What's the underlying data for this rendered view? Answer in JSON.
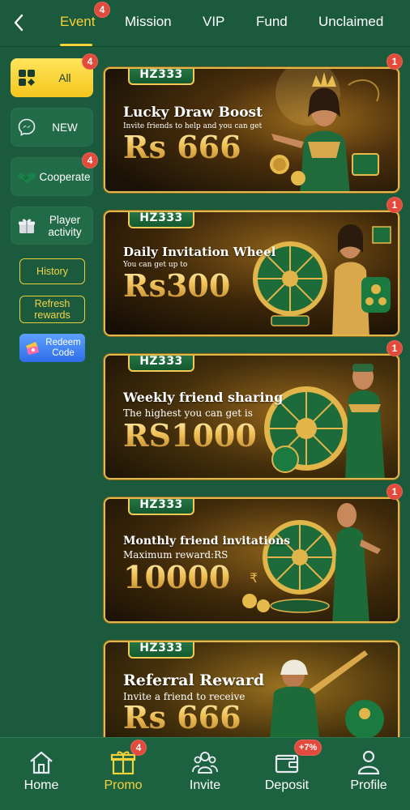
{
  "top_nav": {
    "tabs": [
      {
        "label": "Event",
        "badge": "4",
        "active": true
      },
      {
        "label": "Mission"
      },
      {
        "label": "VIP"
      },
      {
        "label": "Fund"
      },
      {
        "label": "Unclaimed"
      }
    ]
  },
  "sidebar": {
    "items": [
      {
        "label": "All",
        "badge": "4",
        "active": true,
        "icon": "grid-icon"
      },
      {
        "label": "NEW",
        "icon": "messenger-icon"
      },
      {
        "label": "Cooperate",
        "badge": "4",
        "icon": "handshake-icon"
      },
      {
        "label": "Player activity",
        "icon": "gift-icon"
      }
    ],
    "history_label": "History",
    "refresh_label": "Refresh rewards",
    "redeem_label": "Redeem Code"
  },
  "banners": [
    {
      "logo": "HZ333",
      "title": "Lucky Draw Boost",
      "subtitle": "Invite friends to help and you can get",
      "amount": "Rs 666",
      "badge": "1"
    },
    {
      "logo": "HZ333",
      "title": "Daily Invitation Wheel",
      "subtitle": "You can get up to",
      "amount": "Rs300",
      "badge": "1"
    },
    {
      "logo": "HZ333",
      "title": "Weekly friend sharing",
      "subtitle": "The highest you can get is",
      "amount": "RS1000",
      "badge": "1"
    },
    {
      "logo": "HZ333",
      "title": "Monthly friend invitations",
      "subtitle": "Maximum reward:RS",
      "amount": "10000",
      "badge": "1"
    },
    {
      "logo": "HZ333",
      "title": "Referral Reward",
      "subtitle": "Invite a friend to receive",
      "amount": "Rs 666"
    }
  ],
  "bottom_nav": {
    "items": [
      {
        "label": "Home",
        "icon": "home-icon"
      },
      {
        "label": "Promo",
        "badge": "4",
        "active": true,
        "icon": "gift-box-icon"
      },
      {
        "label": "Invite",
        "icon": "people-icon"
      },
      {
        "label": "Deposit",
        "badge": "+7%",
        "icon": "wallet-icon"
      },
      {
        "label": "Profile",
        "icon": "person-icon"
      }
    ]
  },
  "colors": {
    "background": "#1b5a3c",
    "accent": "#f5d23a",
    "badge": "#e24a3b",
    "banner_border": "#e2b84a"
  }
}
